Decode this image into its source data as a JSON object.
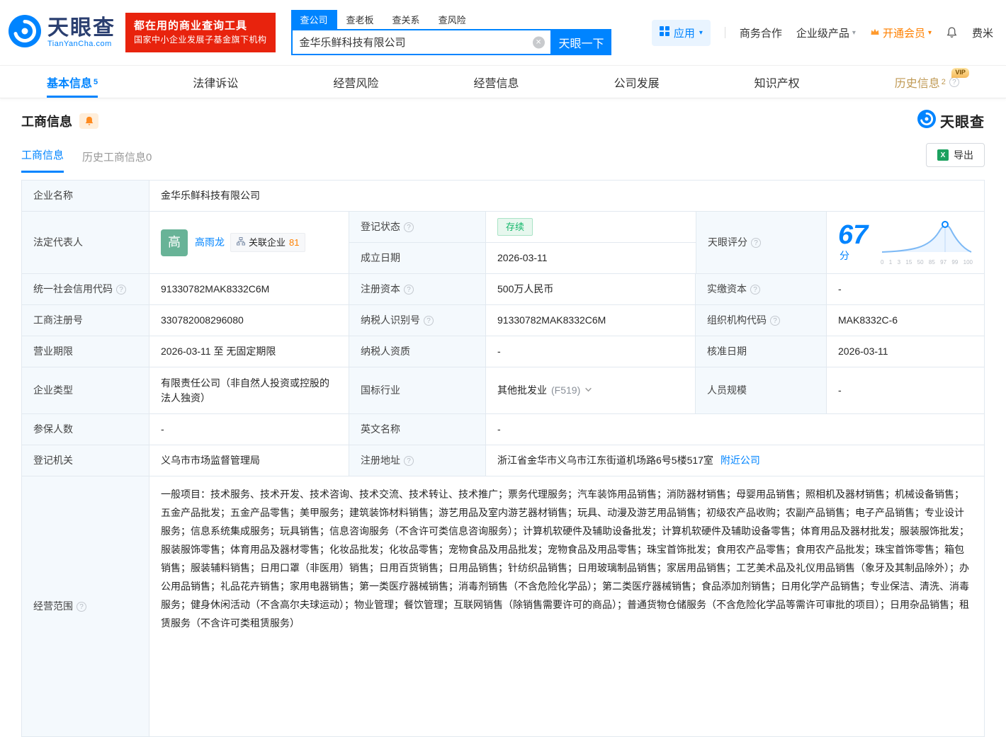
{
  "header": {
    "logo": {
      "brand": "天眼查",
      "domain": "TianYanCha.com"
    },
    "promo": {
      "line1": "都在用的商业查询工具",
      "line2": "国家中小企业发展子基金旗下机构"
    },
    "search": {
      "tabs": [
        {
          "label": "查公司"
        },
        {
          "label": "查老板"
        },
        {
          "label": "查关系"
        },
        {
          "label": "查风险"
        }
      ],
      "value": "金华乐鲜科技有限公司",
      "button": "天眼一下"
    },
    "menu": {
      "apps": "应用",
      "cooperation": "商务合作",
      "enterprise": "企业级产品",
      "vip": "开通会员",
      "user": "费米"
    }
  },
  "nav": {
    "tabs": [
      {
        "label": "基本信息",
        "count": "5"
      },
      {
        "label": "法律诉讼"
      },
      {
        "label": "经营风险"
      },
      {
        "label": "经营信息"
      },
      {
        "label": "公司发展"
      },
      {
        "label": "知识产权"
      },
      {
        "label": "历史信息",
        "count": "2",
        "badge": "VIP"
      }
    ]
  },
  "section": {
    "title": "工商信息",
    "watermark": "天眼查",
    "subtabs": [
      {
        "label": "工商信息"
      },
      {
        "label": "历史工商信息0"
      }
    ],
    "export": "导出"
  },
  "table": {
    "company_name": {
      "label": "企业名称",
      "value": "金华乐鲜科技有限公司"
    },
    "legal_rep": {
      "label": "法定代表人",
      "name": "高雨龙",
      "avatar": "高",
      "related_label": "关联企业",
      "related_count": "81"
    },
    "reg_status": {
      "label": "登记状态",
      "value": "存续"
    },
    "establish_date": {
      "label": "成立日期",
      "value": "2026-03-11"
    },
    "score": {
      "label": "天眼评分",
      "value": "67",
      "unit": "分",
      "ticks": [
        "0",
        "1",
        "3",
        "15",
        "50",
        "85",
        "97",
        "99",
        "100"
      ]
    },
    "credit_code": {
      "label": "统一社会信用代码",
      "value": "91330782MAK8332C6M"
    },
    "reg_capital": {
      "label": "注册资本",
      "value": "500万人民币"
    },
    "paid_capital": {
      "label": "实缴资本",
      "value": "-"
    },
    "reg_number": {
      "label": "工商注册号",
      "value": "330782008296080"
    },
    "taxpayer_id": {
      "label": "纳税人识别号",
      "value": "91330782MAK8332C6M"
    },
    "org_code": {
      "label": "组织机构代码",
      "value": "MAK8332C-6"
    },
    "business_term": {
      "label": "营业期限",
      "value": "2026-03-11 至 无固定期限"
    },
    "taxpayer_quality": {
      "label": "纳税人资质",
      "value": "-"
    },
    "approval_date": {
      "label": "核准日期",
      "value": "2026-03-11"
    },
    "company_type": {
      "label": "企业类型",
      "value": "有限责任公司（非自然人投资或控股的法人独资）"
    },
    "industry": {
      "label": "国标行业",
      "value": "其他批发业",
      "code": "(F519)"
    },
    "staff_size": {
      "label": "人员规模",
      "value": "-"
    },
    "insured_count": {
      "label": "参保人数",
      "value": "-"
    },
    "english_name": {
      "label": "英文名称",
      "value": "-"
    },
    "reg_authority": {
      "label": "登记机关",
      "value": "义乌市市场监督管理局"
    },
    "reg_address": {
      "label": "注册地址",
      "value": "浙江省金华市义乌市江东街道机场路6号5楼517室",
      "link": "附近公司"
    },
    "business_scope": {
      "label": "经营范围",
      "value": "一般项目：技术服务、技术开发、技术咨询、技术交流、技术转让、技术推广；票务代理服务；汽车装饰用品销售；消防器材销售；母婴用品销售；照相机及器材销售；机械设备销售；五金产品批发；五金产品零售；美甲服务；建筑装饰材料销售；游艺用品及室内游艺器材销售；玩具、动漫及游艺用品销售；初级农产品收购；农副产品销售；电子产品销售；专业设计服务；信息系统集成服务；玩具销售；信息咨询服务（不含许可类信息咨询服务）；计算机软硬件及辅助设备批发；计算机软硬件及辅助设备零售；体育用品及器材批发；服装服饰批发；服装服饰零售；体育用品及器材零售；化妆品批发；化妆品零售；宠物食品及用品批发；宠物食品及用品零售；珠宝首饰批发；食用农产品零售；食用农产品批发；珠宝首饰零售；箱包销售；服装辅料销售；日用口罩（非医用）销售；日用百货销售；日用品销售；针纺织品销售；日用玻璃制品销售；家居用品销售；工艺美术品及礼仪用品销售（象牙及其制品除外）；办公用品销售；礼品花卉销售；家用电器销售；第一类医疗器械销售；消毒剂销售（不含危险化学品）；第二类医疗器械销售；食品添加剂销售；日用化学产品销售；专业保洁、清洗、消毒服务；健身休闲活动（不含高尔夫球运动）；物业管理；餐饮管理；互联网销售（除销售需要许可的商品）；普通货物仓储服务（不含危险化学品等需许可审批的项目）；日用杂品销售；租赁服务（不含许可类租赁服务）"
    }
  }
}
